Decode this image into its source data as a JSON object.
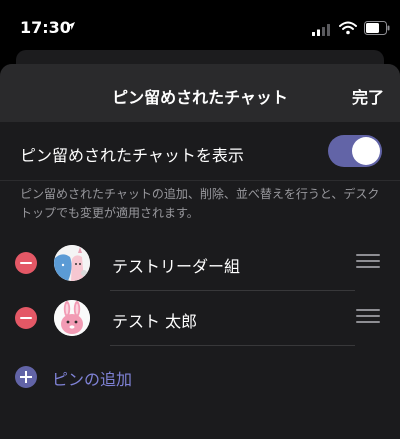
{
  "status_bar": {
    "time": "17:30"
  },
  "header": {
    "title": "ピン留めされたチャット",
    "done_label": "完了"
  },
  "toggle": {
    "label": "ピン留めされたチャットを表示",
    "enabled": true,
    "color": "#6264a7"
  },
  "description": "ピン留めされたチャットの追加、削除、並べ替えを行うと、デスクトップでも変更が適用されます。",
  "pinned_chats": [
    {
      "name": "テストリーダー組",
      "avatar_icon": "group-avatar-icon"
    },
    {
      "name": "テスト 太郎",
      "avatar_icon": "rabbit-avatar-icon"
    }
  ],
  "add_pin_label": "ピンの追加",
  "colors": {
    "accent": "#6264a7",
    "remove": "#e45866",
    "link": "#7f82d6"
  }
}
